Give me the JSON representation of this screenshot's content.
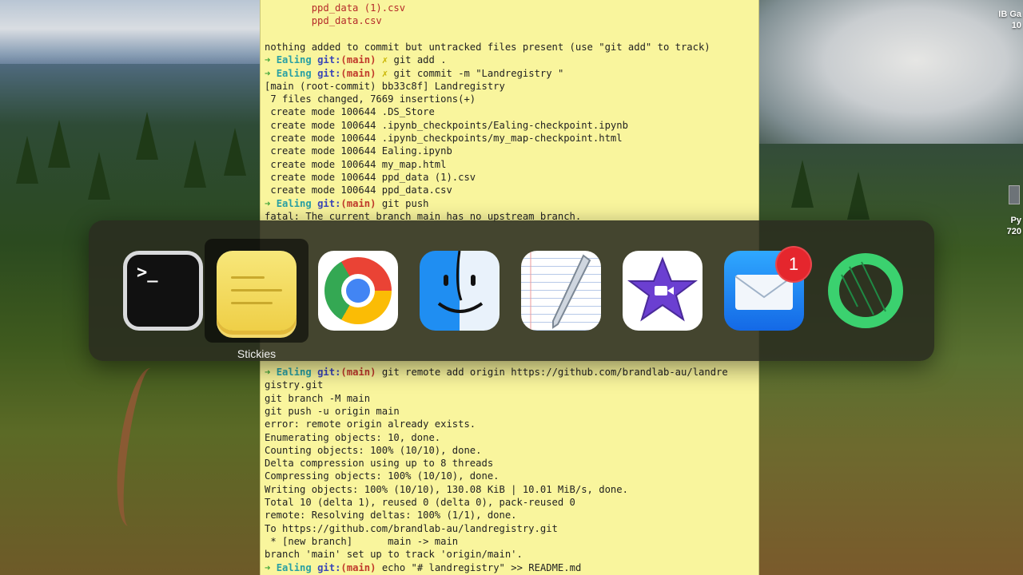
{
  "desktop": {
    "right_edge_texts": [
      "IB Ga",
      "10",
      "Py",
      "720"
    ]
  },
  "terminal": {
    "lines_top": [
      {
        "kind": "untracked",
        "text": "        ppd_data (1).csv"
      },
      {
        "kind": "untracked",
        "text": "        ppd_data.csv"
      },
      {
        "kind": "plain",
        "text": ""
      },
      {
        "kind": "plain",
        "text": "nothing added to commit but untracked files present (use \"git add\" to track)"
      },
      {
        "kind": "prompt",
        "dir": "Ealing",
        "branch": "main",
        "dirty": "✗",
        "cmd": "git add ."
      },
      {
        "kind": "prompt",
        "dir": "Ealing",
        "branch": "main",
        "dirty": "✗",
        "cmd": "git commit -m \"Landregistry \""
      },
      {
        "kind": "plain",
        "text": "[main (root-commit) bb33c8f] Landregistry"
      },
      {
        "kind": "plain",
        "text": " 7 files changed, 7669 insertions(+)"
      },
      {
        "kind": "plain",
        "text": " create mode 100644 .DS_Store"
      },
      {
        "kind": "plain",
        "text": " create mode 100644 .ipynb_checkpoints/Ealing-checkpoint.ipynb"
      },
      {
        "kind": "plain",
        "text": " create mode 100644 .ipynb_checkpoints/my_map-checkpoint.html"
      },
      {
        "kind": "plain",
        "text": " create mode 100644 Ealing.ipynb"
      },
      {
        "kind": "plain",
        "text": " create mode 100644 my_map.html"
      },
      {
        "kind": "plain",
        "text": " create mode 100644 ppd_data (1).csv"
      },
      {
        "kind": "plain",
        "text": " create mode 100644 ppd_data.csv"
      },
      {
        "kind": "prompt",
        "dir": "Ealing",
        "branch": "main",
        "dirty": "",
        "cmd": "git push"
      },
      {
        "kind": "plain",
        "text": "fatal: The current branch main has no upstream branch."
      }
    ],
    "lines_bottom": [
      {
        "kind": "prompt",
        "dir": "Ealing",
        "branch": "main",
        "dirty": "",
        "cmd": "git remote add origin https://github.com/brandlab-au/landre"
      },
      {
        "kind": "plain",
        "text": "gistry.git"
      },
      {
        "kind": "plain",
        "text": "git branch -M main"
      },
      {
        "kind": "plain",
        "text": "git push -u origin main"
      },
      {
        "kind": "plain",
        "text": "error: remote origin already exists."
      },
      {
        "kind": "plain",
        "text": "Enumerating objects: 10, done."
      },
      {
        "kind": "plain",
        "text": "Counting objects: 100% (10/10), done."
      },
      {
        "kind": "plain",
        "text": "Delta compression using up to 8 threads"
      },
      {
        "kind": "plain",
        "text": "Compressing objects: 100% (10/10), done."
      },
      {
        "kind": "plain",
        "text": "Writing objects: 100% (10/10), 130.08 KiB | 10.01 MiB/s, done."
      },
      {
        "kind": "plain",
        "text": "Total 10 (delta 1), reused 0 (delta 0), pack-reused 0"
      },
      {
        "kind": "plain",
        "text": "remote: Resolving deltas: 100% (1/1), done."
      },
      {
        "kind": "plain",
        "text": "To https://github.com/brandlab-au/landregistry.git"
      },
      {
        "kind": "plain",
        "text": " * [new branch]      main -> main"
      },
      {
        "kind": "plain",
        "text": "branch 'main' set up to track 'origin/main'."
      },
      {
        "kind": "prompt",
        "dir": "Ealing",
        "branch": "main",
        "dirty": "",
        "cmd": "echo \"# landregistry\" >> README.md"
      }
    ],
    "prompt_arrow": "➜",
    "git_label": "git:"
  },
  "app_switcher": {
    "selected_label": "Stickies",
    "apps": [
      {
        "name": "Terminal",
        "icon": "terminal-icon",
        "selected": false
      },
      {
        "name": "Stickies",
        "icon": "stickies-icon",
        "selected": true
      },
      {
        "name": "Google Chrome",
        "icon": "chrome-icon",
        "selected": false
      },
      {
        "name": "Finder",
        "icon": "finder-icon",
        "selected": false
      },
      {
        "name": "TextEdit",
        "icon": "textedit-icon",
        "selected": false
      },
      {
        "name": "iMovie",
        "icon": "imovie-icon",
        "selected": false
      },
      {
        "name": "Mail",
        "icon": "mail-icon",
        "selected": false,
        "badge": "1"
      },
      {
        "name": "Anaconda Navigator",
        "icon": "anaconda-ring-icon",
        "selected": false
      }
    ]
  }
}
